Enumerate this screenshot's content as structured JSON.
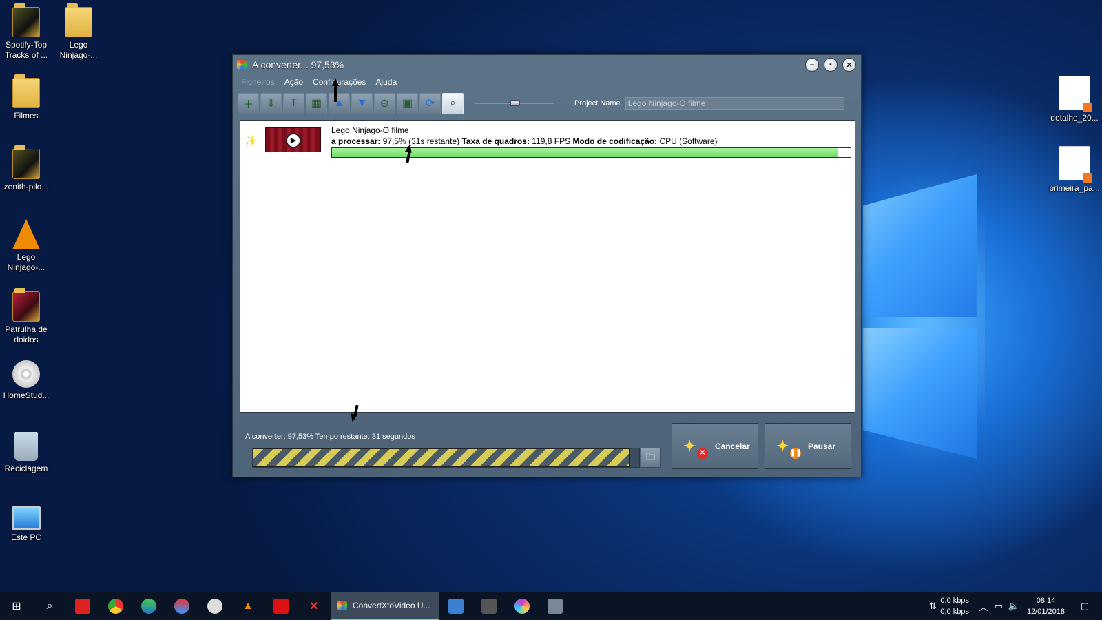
{
  "desktop": {
    "left_icons": [
      {
        "label": "Spotify-Top Tracks of ...",
        "icon": "folder-image-icon"
      },
      {
        "label": "Lego Ninjago-...",
        "icon": "folder-icon"
      },
      {
        "label": "Filmes",
        "icon": "folder-icon"
      },
      {
        "label": "zenith-pilo...",
        "icon": "folder-image-icon"
      },
      {
        "label": "Lego Ninjago-...",
        "icon": "vlc-icon"
      },
      {
        "label": "Patrulha de doidos",
        "icon": "folder-image-icon"
      },
      {
        "label": "HomeStud...",
        "icon": "disc-icon"
      },
      {
        "label": "Reciclagem",
        "icon": "recycle-bin-icon"
      },
      {
        "label": "Este PC",
        "icon": "computer-icon"
      }
    ],
    "right_icons": [
      {
        "label": "detalhe_20...",
        "icon": "document-icon"
      },
      {
        "label": "primeira_pa...",
        "icon": "document-icon"
      }
    ]
  },
  "window": {
    "title": "A converter... 97,53%",
    "menu": [
      "Ficheiros",
      "Ação",
      "Configurações",
      "Ajuda"
    ],
    "toolbar_icons": [
      "add-file-icon",
      "add-folder-icon",
      "text-icon",
      "table-icon",
      "move-up-icon",
      "move-down-icon",
      "remove-icon",
      "preview-icon",
      "convert-icon",
      "search-icon"
    ],
    "project_name_label": "Project Name",
    "project_name_value": "Lego Ninjago-O filme",
    "zoom_slider_value": 0.5
  },
  "item": {
    "title": "Lego Ninjago-O filme",
    "status_label": "a processar:",
    "status_value": "97,5% (31s restante)",
    "framerate_label": "Taxa de quadros:",
    "framerate_value": "119,8 FPS",
    "encoding_label": "Modo de codificação:",
    "encoding_value": "CPU (Software)",
    "progress": 0.975
  },
  "bottom": {
    "status_text": "A converter: 97,53% Tempo restante: 31 segundos",
    "progress": 0.9753,
    "cancel_label": "Cancelar",
    "pause_label": "Pausar"
  },
  "taskbar": {
    "active_app": "ConvertXtoVideo U...",
    "net_down": "0,0 kbps",
    "net_up": "0,0 kbps",
    "time": "08:14",
    "date": "12/01/2018"
  },
  "colors": {
    "window_bg": "#5d7488",
    "item_progress": "#70dc66",
    "main_progress_stripe": "#d8cc58",
    "taskbar": "#0b1424"
  }
}
